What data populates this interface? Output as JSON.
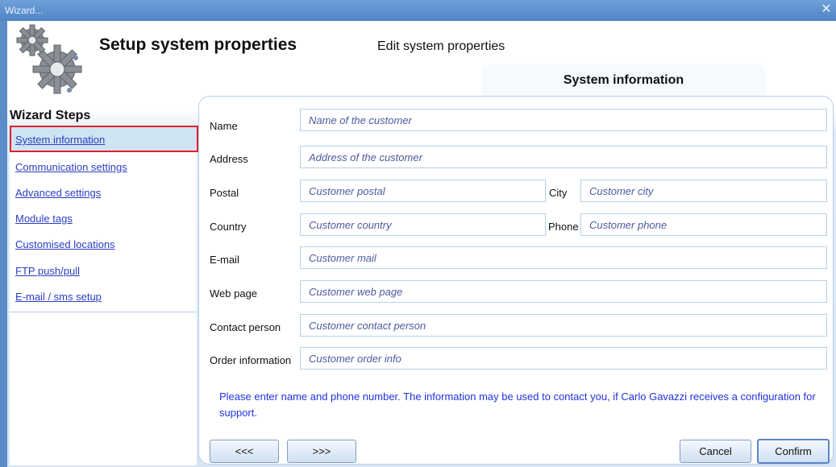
{
  "window": {
    "title": "Wizard..."
  },
  "header": {
    "title": "Setup system properties",
    "subtitle": "Edit system properties",
    "tab": "System information"
  },
  "steps": {
    "title": "Wizard Steps",
    "items": [
      "System information",
      "Communication settings",
      "Advanced settings",
      "Module tags",
      "Customised locations",
      "FTP push/pull",
      "E-mail / sms setup"
    ]
  },
  "form": {
    "name": {
      "label": "Name",
      "placeholder": "Name of the customer"
    },
    "address": {
      "label": "Address",
      "placeholder": "Address of the customer"
    },
    "postal": {
      "label": "Postal",
      "placeholder": "Customer postal"
    },
    "city": {
      "label": "City",
      "placeholder": "Customer city"
    },
    "country": {
      "label": "Country",
      "placeholder": "Customer country"
    },
    "phone": {
      "label": "Phone",
      "placeholder": "Customer phone"
    },
    "email": {
      "label": "E-mail",
      "placeholder": "Customer mail"
    },
    "webpage": {
      "label": "Web page",
      "placeholder": "Customer web page"
    },
    "contact": {
      "label": "Contact person",
      "placeholder": "Customer contact person"
    },
    "order": {
      "label": "Order information",
      "placeholder": "Customer order info"
    },
    "note": "Please enter name and phone number. The information may be used to contact you, if Carlo Gavazzi receives a configuration for support."
  },
  "buttons": {
    "prev": "<<<",
    "next": ">>>",
    "cancel": "Cancel",
    "confirm": "Confirm"
  }
}
